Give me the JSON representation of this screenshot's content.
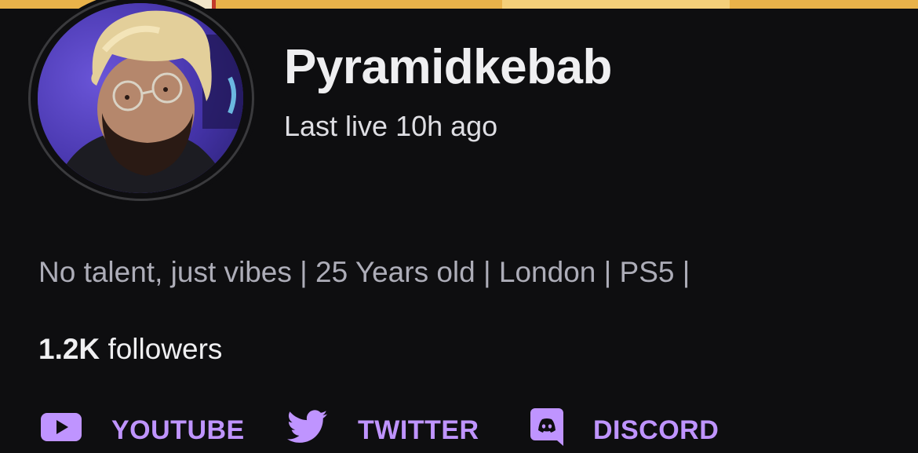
{
  "channel": {
    "name": "Pyramidkebab",
    "status": "Last live 10h ago",
    "bio": "No talent, just vibes | 25 Years old | London | PS5 |",
    "followers_count": "1.2K",
    "followers_label": "followers"
  },
  "social_links": [
    {
      "label": "YOUTUBE",
      "icon": "youtube-icon"
    },
    {
      "label": "TWITTER",
      "icon": "twitter-icon"
    },
    {
      "label": "DISCORD",
      "icon": "discord-icon"
    }
  ],
  "colors": {
    "background": "#0e0e10",
    "link": "#bf94ff",
    "text_primary": "#efeff1",
    "text_secondary": "#adadb8",
    "banner": "#e9b24a"
  }
}
